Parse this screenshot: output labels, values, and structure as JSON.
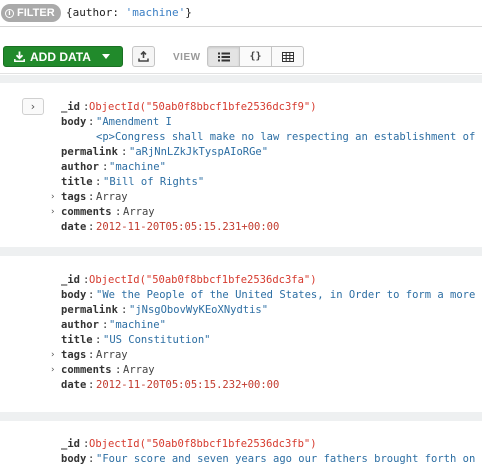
{
  "filter": {
    "label": "FILTER",
    "query_prefix": "{author: ",
    "query_value": "'machine'",
    "query_suffix": "}"
  },
  "toolbar": {
    "add_data_label": "ADD DATA",
    "view_label": "VIEW",
    "view_json_label": "{}"
  },
  "documents": [
    {
      "fields": {
        "id": {
          "key": "_id",
          "value": "ObjectId(\"50ab0f8bbcf1bfe2536dc3f9\")"
        },
        "body": {
          "key": "body",
          "line1": "\"Amendment I",
          "line2": "<p>Congress shall make no law respecting an establishment of religion"
        },
        "permalink": {
          "key": "permalink",
          "value": "\"aRjNnLZkJkTyspAIoRGe\""
        },
        "author": {
          "key": "author",
          "value": "\"machine\""
        },
        "title": {
          "key": "title",
          "value": "\"Bill of Rights\""
        },
        "tags": {
          "key": "tags",
          "value": "Array"
        },
        "comments": {
          "key": "comments",
          "value": "Array"
        },
        "date": {
          "key": "date",
          "value": "2012-11-20T05:05:15.231+00:00"
        }
      }
    },
    {
      "fields": {
        "id": {
          "key": "_id",
          "value": "ObjectId(\"50ab0f8bbcf1bfe2536dc3fa\")"
        },
        "body": {
          "key": "body",
          "value": "\"We the People of the United States, in Order to form a more perfect Union"
        },
        "permalink": {
          "key": "permalink",
          "value": "\"jNsgObovWyKEoXNydtis\""
        },
        "author": {
          "key": "author",
          "value": "\"machine\""
        },
        "title": {
          "key": "title",
          "value": "\"US Constitution\""
        },
        "tags": {
          "key": "tags",
          "value": "Array"
        },
        "comments": {
          "key": "comments",
          "value": "Array"
        },
        "date": {
          "key": "date",
          "value": "2012-11-20T05:05:15.232+00:00"
        }
      }
    },
    {
      "fields": {
        "id": {
          "key": "_id",
          "value": "ObjectId(\"50ab0f8bbcf1bfe2536dc3fb\")"
        },
        "body": {
          "key": "body",
          "value": "\"Four score and seven years ago our fathers brought forth on this continent"
        }
      }
    }
  ],
  "icons": {
    "info": "info-icon",
    "download": "download-icon",
    "export": "export-icon",
    "list_view": "list-view-icon",
    "table_view": "table-view-icon",
    "expand": "chevron-right-icon",
    "field_expand": "triangle-right-icon"
  },
  "colors": {
    "add_button": "#218a2b",
    "object_id": "#d63a2e",
    "string_value": "#2c6ea3",
    "date_value": "#c23b2e",
    "filter_pill": "#aaaaaa"
  }
}
